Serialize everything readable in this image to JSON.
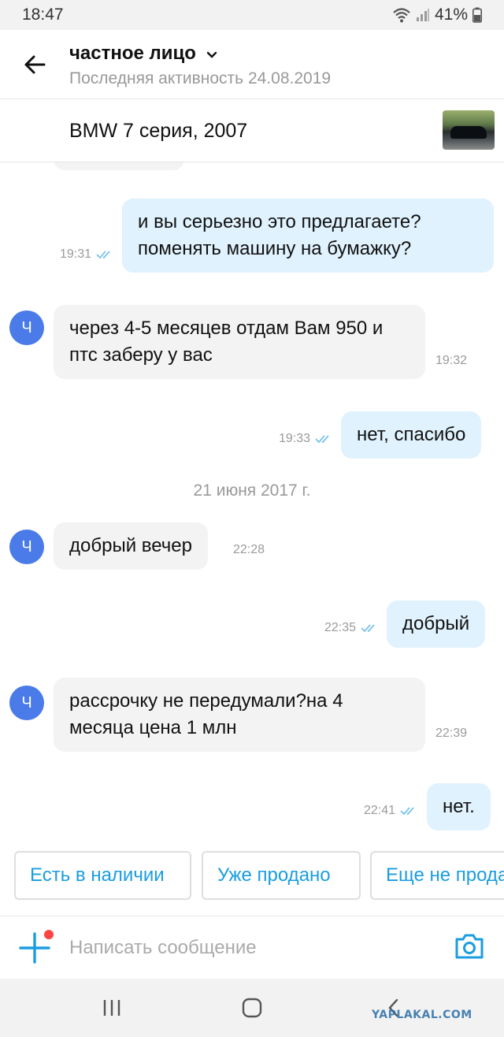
{
  "status_bar": {
    "time": "18:47",
    "battery": "41%"
  },
  "header": {
    "contact_name": "частное лицо",
    "last_seen": "Последняя активность 24.08.2019"
  },
  "ad": {
    "title": "BMW 7 серия, 2007"
  },
  "avatar_letter": "Ч",
  "messages": [
    {
      "direction": "out",
      "text": "и вы серьезно это предлагаете? поменять машину на бумажку?",
      "time": "19:31"
    },
    {
      "direction": "in",
      "text": "через 4-5 месяцев отдам Вам 950 и птс заберу у вас",
      "time": "19:32"
    },
    {
      "direction": "out",
      "text": "нет, спасибо",
      "time": "19:33"
    },
    {
      "direction": "in",
      "text": "добрый вечер",
      "time": "22:28"
    },
    {
      "direction": "out",
      "text": "добрый",
      "time": "22:35"
    },
    {
      "direction": "in",
      "text": "рассрочку не передумали?на 4 месяца цена 1 млн",
      "time": "22:39"
    },
    {
      "direction": "out",
      "text": "нет.",
      "time": "22:41"
    }
  ],
  "date_separator": "21 июня 2017 г.",
  "quick_replies": [
    "Есть в наличии",
    "Уже продано",
    "Еще не продано"
  ],
  "composer": {
    "placeholder": "Написать сообщение"
  },
  "watermark": "YAPLAKAL.COM",
  "colors": {
    "accent": "#1a9de0",
    "outgoing_bubble": "#e0f2fd",
    "incoming_bubble": "#f3f3f3",
    "avatar": "#4a7be8",
    "badge": "#ff4444"
  }
}
